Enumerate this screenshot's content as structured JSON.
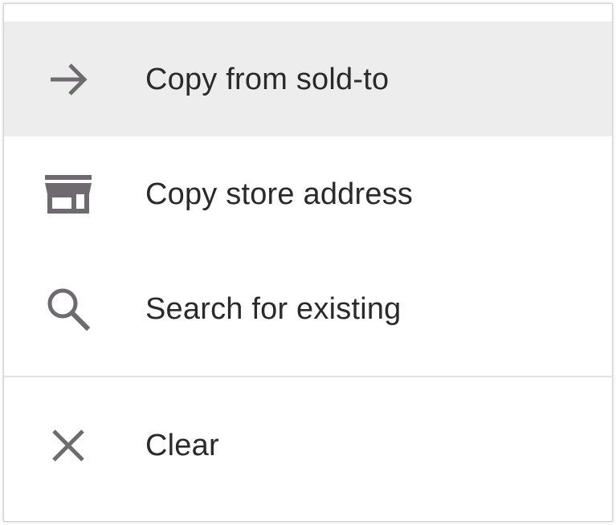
{
  "menu": {
    "items": [
      {
        "label": "Copy from sold-to",
        "icon": "arrow-right-icon",
        "highlighted": true
      },
      {
        "label": "Copy store address",
        "icon": "store-icon",
        "highlighted": false
      },
      {
        "label": "Search for existing",
        "icon": "search-icon",
        "highlighted": false
      }
    ],
    "clear": {
      "label": "Clear",
      "icon": "close-icon"
    }
  },
  "colors": {
    "icon": "#6e6a70",
    "text": "#2a2a2a",
    "highlight": "#eeedee",
    "divider": "#e2e2e2"
  }
}
